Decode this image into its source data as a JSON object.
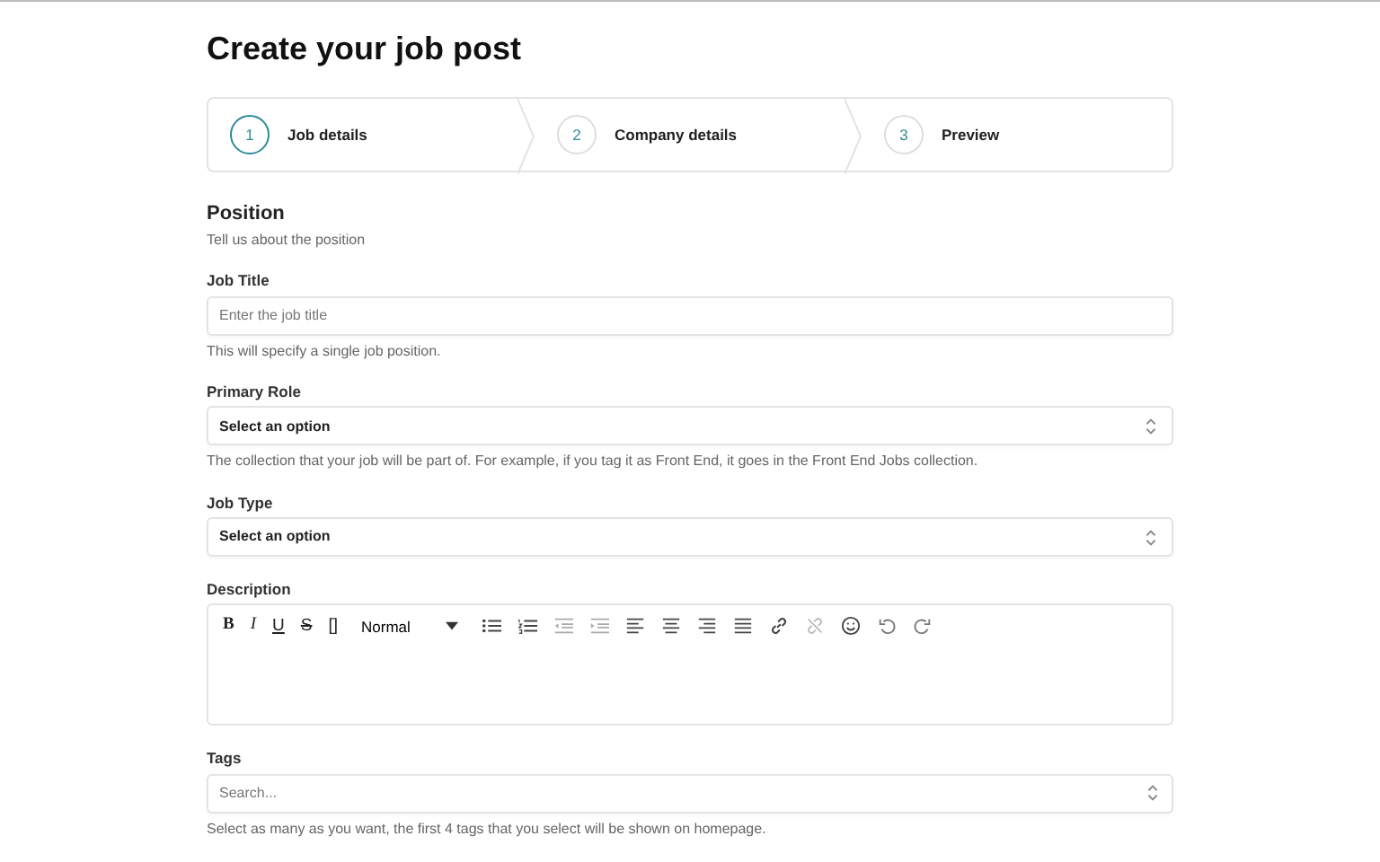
{
  "page_title": "Create your job post",
  "steps": [
    {
      "number": "1",
      "label": "Job details",
      "selected": true
    },
    {
      "number": "2",
      "label": "Company details",
      "selected": false
    },
    {
      "number": "3",
      "label": "Preview",
      "selected": false
    }
  ],
  "section": {
    "title": "Position",
    "subtitle": "Tell us about the position"
  },
  "fields": [
    {
      "kind": "input",
      "label": "Job Title",
      "placeholder": "Enter the job title",
      "help": "This will specify a single job position."
    },
    {
      "kind": "select",
      "label": "Primary Role",
      "value": "Select an option",
      "help": "The collection that your job will be part of. For example, if you tag it as Front End, it goes in the Front End Jobs collection."
    },
    {
      "kind": "select",
      "label": "Job Type",
      "value": "Select an option"
    },
    {
      "kind": "editor",
      "label": "Description",
      "toolbar_text": [
        "B",
        "I",
        "U",
        "S",
        "[]"
      ],
      "format": "Normal"
    },
    {
      "kind": "search",
      "label": "Tags",
      "placeholder": "Search...",
      "help": "Select as many as you want, the first 4 tags that you select will be shown on homepage."
    }
  ]
}
